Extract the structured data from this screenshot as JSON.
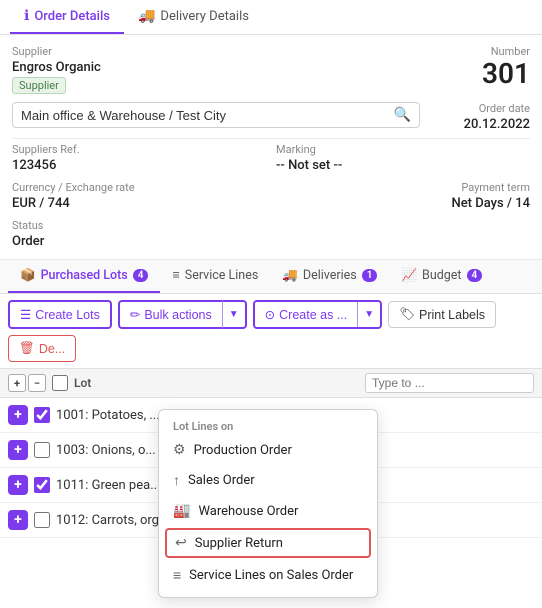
{
  "tabs": {
    "top": [
      {
        "id": "order-details",
        "label": "Order Details",
        "icon": "ℹ️",
        "active": true
      },
      {
        "id": "delivery-details",
        "label": "Delivery Details",
        "icon": "🚚",
        "active": false
      }
    ]
  },
  "order": {
    "supplier_label": "Supplier",
    "supplier_name": "Engros Organic",
    "supplier_badge": "Supplier",
    "warehouse_placeholder": "Main office & Warehouse / Test City",
    "number_label": "Number",
    "number_value": "301",
    "order_date_label": "Order date",
    "order_date_value": "20.12.2022",
    "suppliers_ref_label": "Suppliers Ref.",
    "suppliers_ref_value": "123456",
    "marking_label": "Marking",
    "marking_value": "-- Not set --",
    "currency_label": "Currency / Exchange rate",
    "currency_value": "EUR / 744",
    "payment_term_label": "Payment term",
    "payment_term_value": "Net Days / 14",
    "status_label": "Status",
    "status_value": "Order"
  },
  "section_tabs": [
    {
      "id": "purchased-lots",
      "label": "Purchased Lots",
      "badge": "4",
      "active": true,
      "icon": "📦"
    },
    {
      "id": "service-lines",
      "label": "Service Lines",
      "badge": null,
      "active": false,
      "icon": "≡"
    },
    {
      "id": "deliveries",
      "label": "Deliveries",
      "badge": "1",
      "active": false,
      "icon": "🚚"
    },
    {
      "id": "budget",
      "label": "Budget",
      "badge": "4",
      "active": false,
      "icon": "📈"
    }
  ],
  "toolbar": {
    "create_lots_label": "Create Lots",
    "bulk_actions_label": "Bulk actions",
    "create_as_label": "Create as ...",
    "print_labels_label": "Print Labels",
    "delete_label": "De..."
  },
  "table": {
    "search_placeholder": "Type to ...",
    "lot_column_label": "Lot"
  },
  "rows": [
    {
      "id": "row-1",
      "lot": "1001: Potatoes, ...",
      "checked": true,
      "expanded": false
    },
    {
      "id": "row-2",
      "lot": "1003: Onions, o...",
      "checked": false,
      "expanded": false
    },
    {
      "id": "row-3",
      "lot": "1011: Green pea...",
      "checked": true,
      "expanded": false
    },
    {
      "id": "row-4",
      "lot": "1012: Carrots, organic",
      "checked": false,
      "expanded": false
    }
  ],
  "dropdown": {
    "section_label": "Lot Lines on",
    "items": [
      {
        "id": "production-order",
        "label": "Production Order",
        "icon": "⚙"
      },
      {
        "id": "sales-order",
        "label": "Sales Order",
        "icon": "↑"
      },
      {
        "id": "warehouse-order",
        "label": "Warehouse Order",
        "icon": "🏭"
      },
      {
        "id": "supplier-return",
        "label": "Supplier Return",
        "icon": "↩",
        "highlighted": true
      },
      {
        "id": "service-lines-sales",
        "label": "Service Lines on Sales Order",
        "icon": "≡"
      }
    ]
  },
  "colors": {
    "accent": "#7c3aed",
    "danger": "#e05555"
  }
}
